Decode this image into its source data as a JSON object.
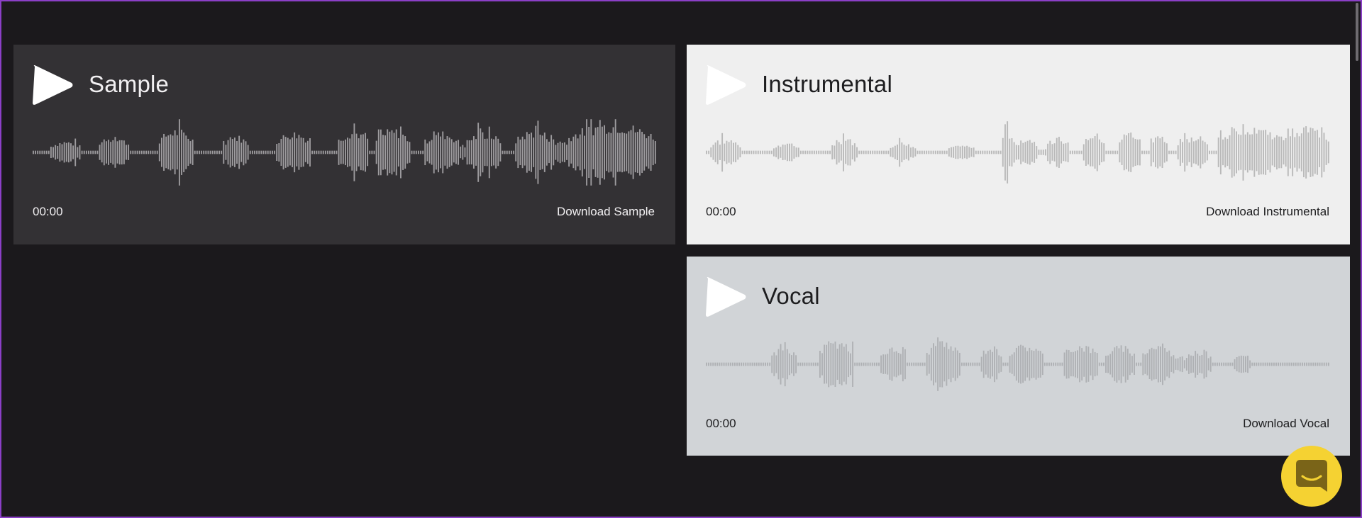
{
  "colors": {
    "background": "#1b191c",
    "frame_border": "#8b3fc6",
    "chat_button": "#f5d232"
  },
  "tracks": [
    {
      "id": "sample",
      "title": "Sample",
      "time": "00:00",
      "download_label": "Download Sample",
      "theme": {
        "bg": "#333134",
        "text": "#f2f0f2",
        "play": "#ffffff",
        "wave": "#9e9c9f"
      },
      "waveform_segments": [
        [
          0.05,
          8
        ],
        [
          0.3,
          14
        ],
        [
          0.05,
          8
        ],
        [
          0.42,
          14
        ],
        [
          0.05,
          13
        ],
        [
          0.62,
          16
        ],
        [
          0.05,
          13
        ],
        [
          0.45,
          12
        ],
        [
          0.05,
          12
        ],
        [
          0.55,
          16
        ],
        [
          0.05,
          12
        ],
        [
          0.6,
          14
        ],
        [
          0.05,
          3
        ],
        [
          0.62,
          16
        ],
        [
          0.05,
          6
        ],
        [
          0.55,
          16
        ],
        [
          0.25,
          3
        ],
        [
          0.55,
          16
        ],
        [
          0.05,
          6
        ],
        [
          0.6,
          18
        ],
        [
          0.35,
          6
        ],
        [
          0.8,
          40
        ]
      ]
    },
    {
      "id": "instrumental",
      "title": "Instrumental",
      "time": "00:00",
      "download_label": "Download Instrumental",
      "theme": {
        "bg": "#efefef",
        "text": "#1d1d1f",
        "play": "#ffffff",
        "wave": "#b9b9b9"
      },
      "waveform_segments": [
        [
          0.05,
          2
        ],
        [
          0.35,
          14
        ],
        [
          0.05,
          14
        ],
        [
          0.25,
          12
        ],
        [
          0.05,
          14
        ],
        [
          0.35,
          12
        ],
        [
          0.05,
          14
        ],
        [
          0.25,
          12
        ],
        [
          0.05,
          14
        ],
        [
          0.2,
          12
        ],
        [
          0.05,
          12
        ],
        [
          0.55,
          6
        ],
        [
          0.4,
          10
        ],
        [
          0.1,
          4
        ],
        [
          0.4,
          10
        ],
        [
          0.05,
          6
        ],
        [
          0.5,
          10
        ],
        [
          0.05,
          6
        ],
        [
          0.55,
          10
        ],
        [
          0.05,
          4
        ],
        [
          0.45,
          8
        ],
        [
          0.05,
          4
        ],
        [
          0.4,
          14
        ],
        [
          0.05,
          4
        ],
        [
          0.75,
          28
        ],
        [
          0.7,
          22
        ]
      ]
    },
    {
      "id": "vocal",
      "title": "Vocal",
      "time": "00:00",
      "download_label": "Download Vocal",
      "theme": {
        "bg": "#d1d4d7",
        "text": "#1d1d1f",
        "play": "#ffffff",
        "wave": "#aeb0b3"
      },
      "waveform_segments": [
        [
          0.04,
          30
        ],
        [
          0.45,
          12
        ],
        [
          0.04,
          10
        ],
        [
          0.65,
          16
        ],
        [
          0.04,
          12
        ],
        [
          0.45,
          12
        ],
        [
          0.04,
          9
        ],
        [
          0.6,
          16
        ],
        [
          0.04,
          9
        ],
        [
          0.5,
          10
        ],
        [
          0.04,
          3
        ],
        [
          0.55,
          16
        ],
        [
          0.04,
          9
        ],
        [
          0.55,
          16
        ],
        [
          0.04,
          3
        ],
        [
          0.5,
          14
        ],
        [
          0.04,
          3
        ],
        [
          0.55,
          14
        ],
        [
          0.25,
          6
        ],
        [
          0.35,
          12
        ],
        [
          0.04,
          10
        ],
        [
          0.25,
          8
        ],
        [
          0.04,
          36
        ]
      ]
    }
  ],
  "chat": {
    "icon": "chat-smile-icon"
  }
}
